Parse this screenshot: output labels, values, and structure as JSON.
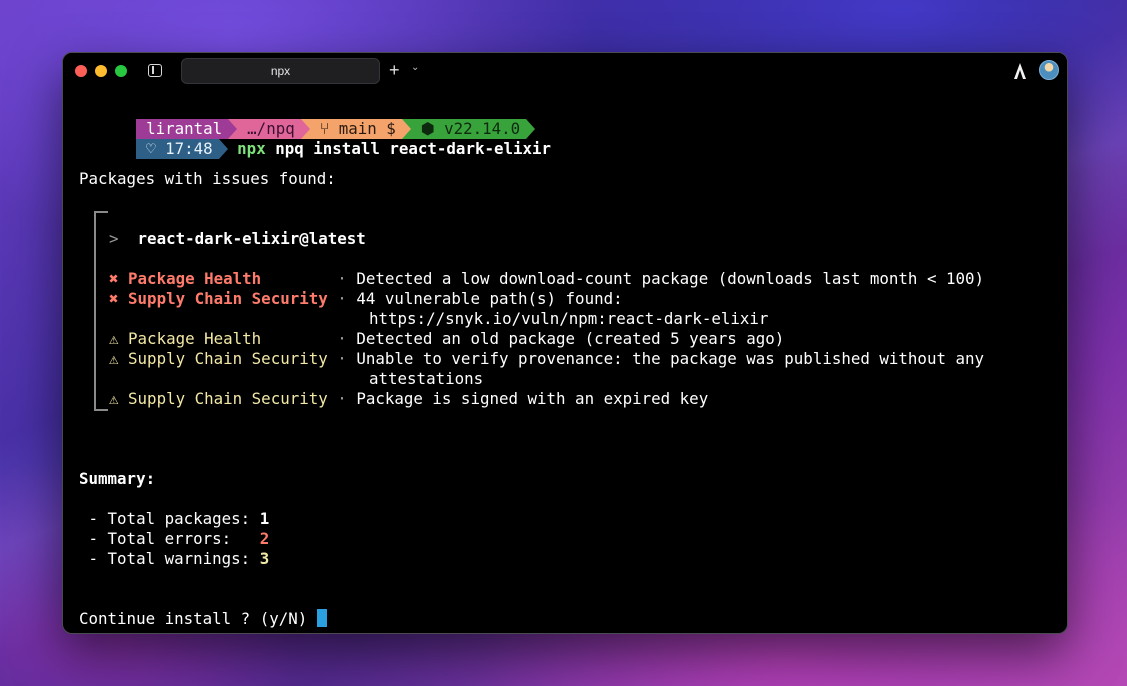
{
  "window": {
    "tab_title": "npx"
  },
  "toolbar": {
    "new_tab_label": "+",
    "tab_menu_label": "⌄"
  },
  "prompt": {
    "user": "lirantal",
    "path": "…/npq",
    "git_branch": " main $",
    "node_version": "⬢ v22.14.0",
    "time": "♡ 17:48",
    "command_prefix": "npx",
    "command": "npq install react-dark-elixir"
  },
  "report": {
    "header": "Packages with issues found:",
    "package_marker": ">",
    "package_name": "react-dark-elixir@latest",
    "issues": [
      {
        "icon": "✖",
        "category": "Package Health       ",
        "separator": "·",
        "message": "Detected a low download-count package (downloads last month < 100)",
        "severity": "error"
      },
      {
        "icon": "✖",
        "category": "Supply Chain Security",
        "separator": "·",
        "message": "44 vulnerable path(s) found:",
        "severity": "error"
      },
      {
        "continuation": "https://snyk.io/vuln/npm:react-dark-elixir"
      },
      {
        "icon": "⚠",
        "category": "Package Health       ",
        "separator": "·",
        "message": "Detected an old package (created 5 years ago)",
        "severity": "warning"
      },
      {
        "icon": "⚠",
        "category": "Supply Chain Security",
        "separator": "·",
        "message": "Unable to verify provenance: the package was published without any",
        "severity": "warning"
      },
      {
        "continuation": "attestations"
      },
      {
        "icon": "⚠",
        "category": "Supply Chain Security",
        "separator": "·",
        "message": "Package is signed with an expired key",
        "severity": "warning"
      }
    ]
  },
  "summary": {
    "title": "Summary:",
    "packages_label": " - Total packages: ",
    "packages_value": "1",
    "errors_label": " - Total errors:   ",
    "errors_value": "2",
    "warnings_label": " - Total warnings: ",
    "warnings_value": "3"
  },
  "confirm": {
    "question": "Continue install ? (y/N) "
  },
  "colors": {
    "error": "#ff7b6b",
    "warning": "#f3e9a6",
    "command": "#7ee27b",
    "cursor": "#2aa0e0"
  }
}
